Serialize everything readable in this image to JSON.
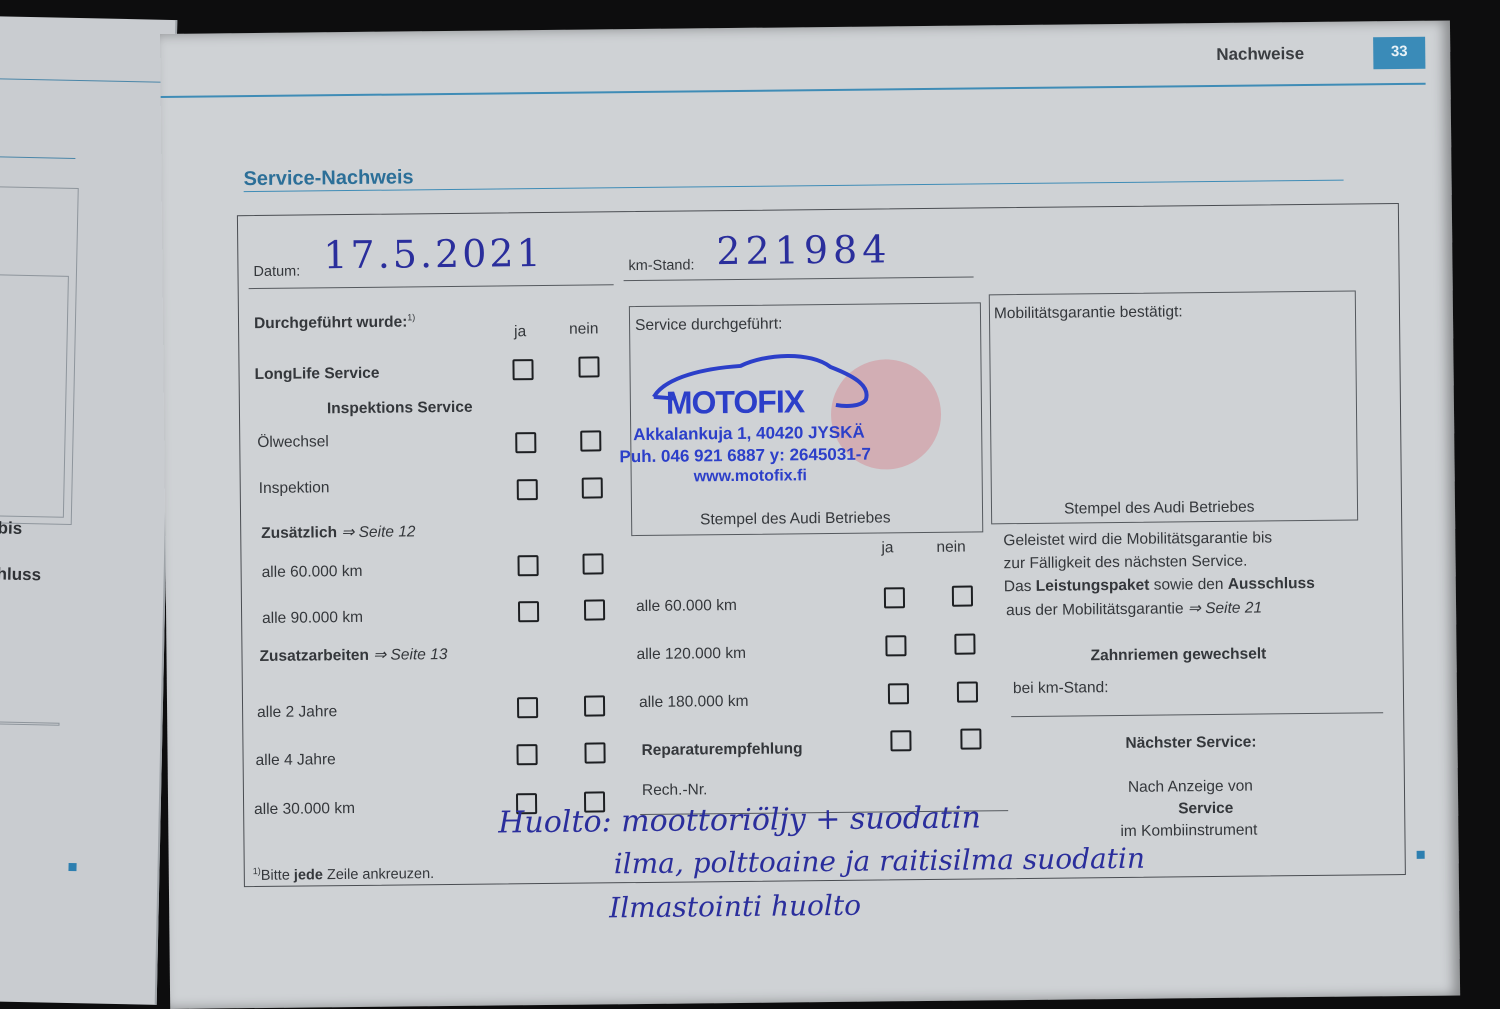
{
  "header": {
    "section": "Nachweise",
    "page_number": "33"
  },
  "title": "Service-Nachweis",
  "left_page": {
    "fragments": [
      "bis",
      "hluss"
    ]
  },
  "form": {
    "datum_label": "Datum:",
    "datum_value": "17.5.2021",
    "km_label": "km-Stand:",
    "km_value": "221984",
    "performed_label": "Durchgeführt wurde:",
    "performed_footnote": "1)",
    "col_ja": "ja",
    "col_nein": "nein",
    "longlife": "LongLife Service",
    "inspektions_heading": "Inspektions Service",
    "oelwechsel": "Ölwechsel",
    "inspektion": "Inspektion",
    "zusaetzlich": "Zusätzlich",
    "zusaetzlich_ref": "⇒ Seite 12",
    "alle_60": "alle 60.000 km",
    "alle_90": "alle 90.000 km",
    "zusatzarbeiten": "Zusatzarbeiten",
    "zusatzarbeiten_ref": "⇒ Seite 13",
    "alle_2": "alle 2 Jahre",
    "alle_4": "alle 4 Jahre",
    "alle_30": "alle 30.000 km",
    "footnote_pre": "Bitte ",
    "footnote_bold": "jede",
    "footnote_post": " Zeile ankreuzen.",
    "service_done_label": "Service durchgeführt:",
    "stamp_label": "Stempel des Audi Betriebes",
    "mid_alle_60": "alle 60.000 km",
    "mid_alle_120": "alle 120.000 km",
    "mid_alle_180": "alle 180.000 km",
    "reparatur": "Reparaturempfehlung",
    "rech_nr": "Rech.-Nr.",
    "mobil_label": "Mobilitätsgarantie bestätigt:",
    "mobil_stamp_label": "Stempel des Audi Betriebes",
    "mobil_text_1": "Geleistet wird die Mobilitätsgarantie bis",
    "mobil_text_2": "zur Fälligkeit des nächsten Service.",
    "mobil_text_3a": "Das ",
    "mobil_text_3b": "Leistungspaket",
    "mobil_text_3c": " sowie den ",
    "mobil_text_3d": "Ausschluss",
    "mobil_text_4a": "aus der Mobilitätsgarantie ",
    "mobil_text_4b": "⇒ Seite 21",
    "zahnriemen": "Zahnriemen gewechselt",
    "bei_km": "bei km-Stand:",
    "naechster": "Nächster Service:",
    "nach_anzeige": "Nach Anzeige von",
    "service_word": "Service",
    "im_kombi": "im Kombiinstrument"
  },
  "stamp": {
    "company": "MOTOFIX",
    "address": "Akkalankuja 1, 40420 JYSKÄ",
    "phone": "Puh. 046 921 6887 y: 2645031-7",
    "web": "www.motofix.fi"
  },
  "handwriting": {
    "line1": "Huolto: moottoriöljy + suodatin",
    "line2": "ilma, polttoaine ja raitisilma suodatin",
    "line3": "Ilmastointi huolto"
  },
  "colors": {
    "accent": "#3a8bb8",
    "stamp_ink": "#2c3fc9",
    "pen_ink": "#2a2e9c",
    "paper": "#cfd2d5"
  }
}
